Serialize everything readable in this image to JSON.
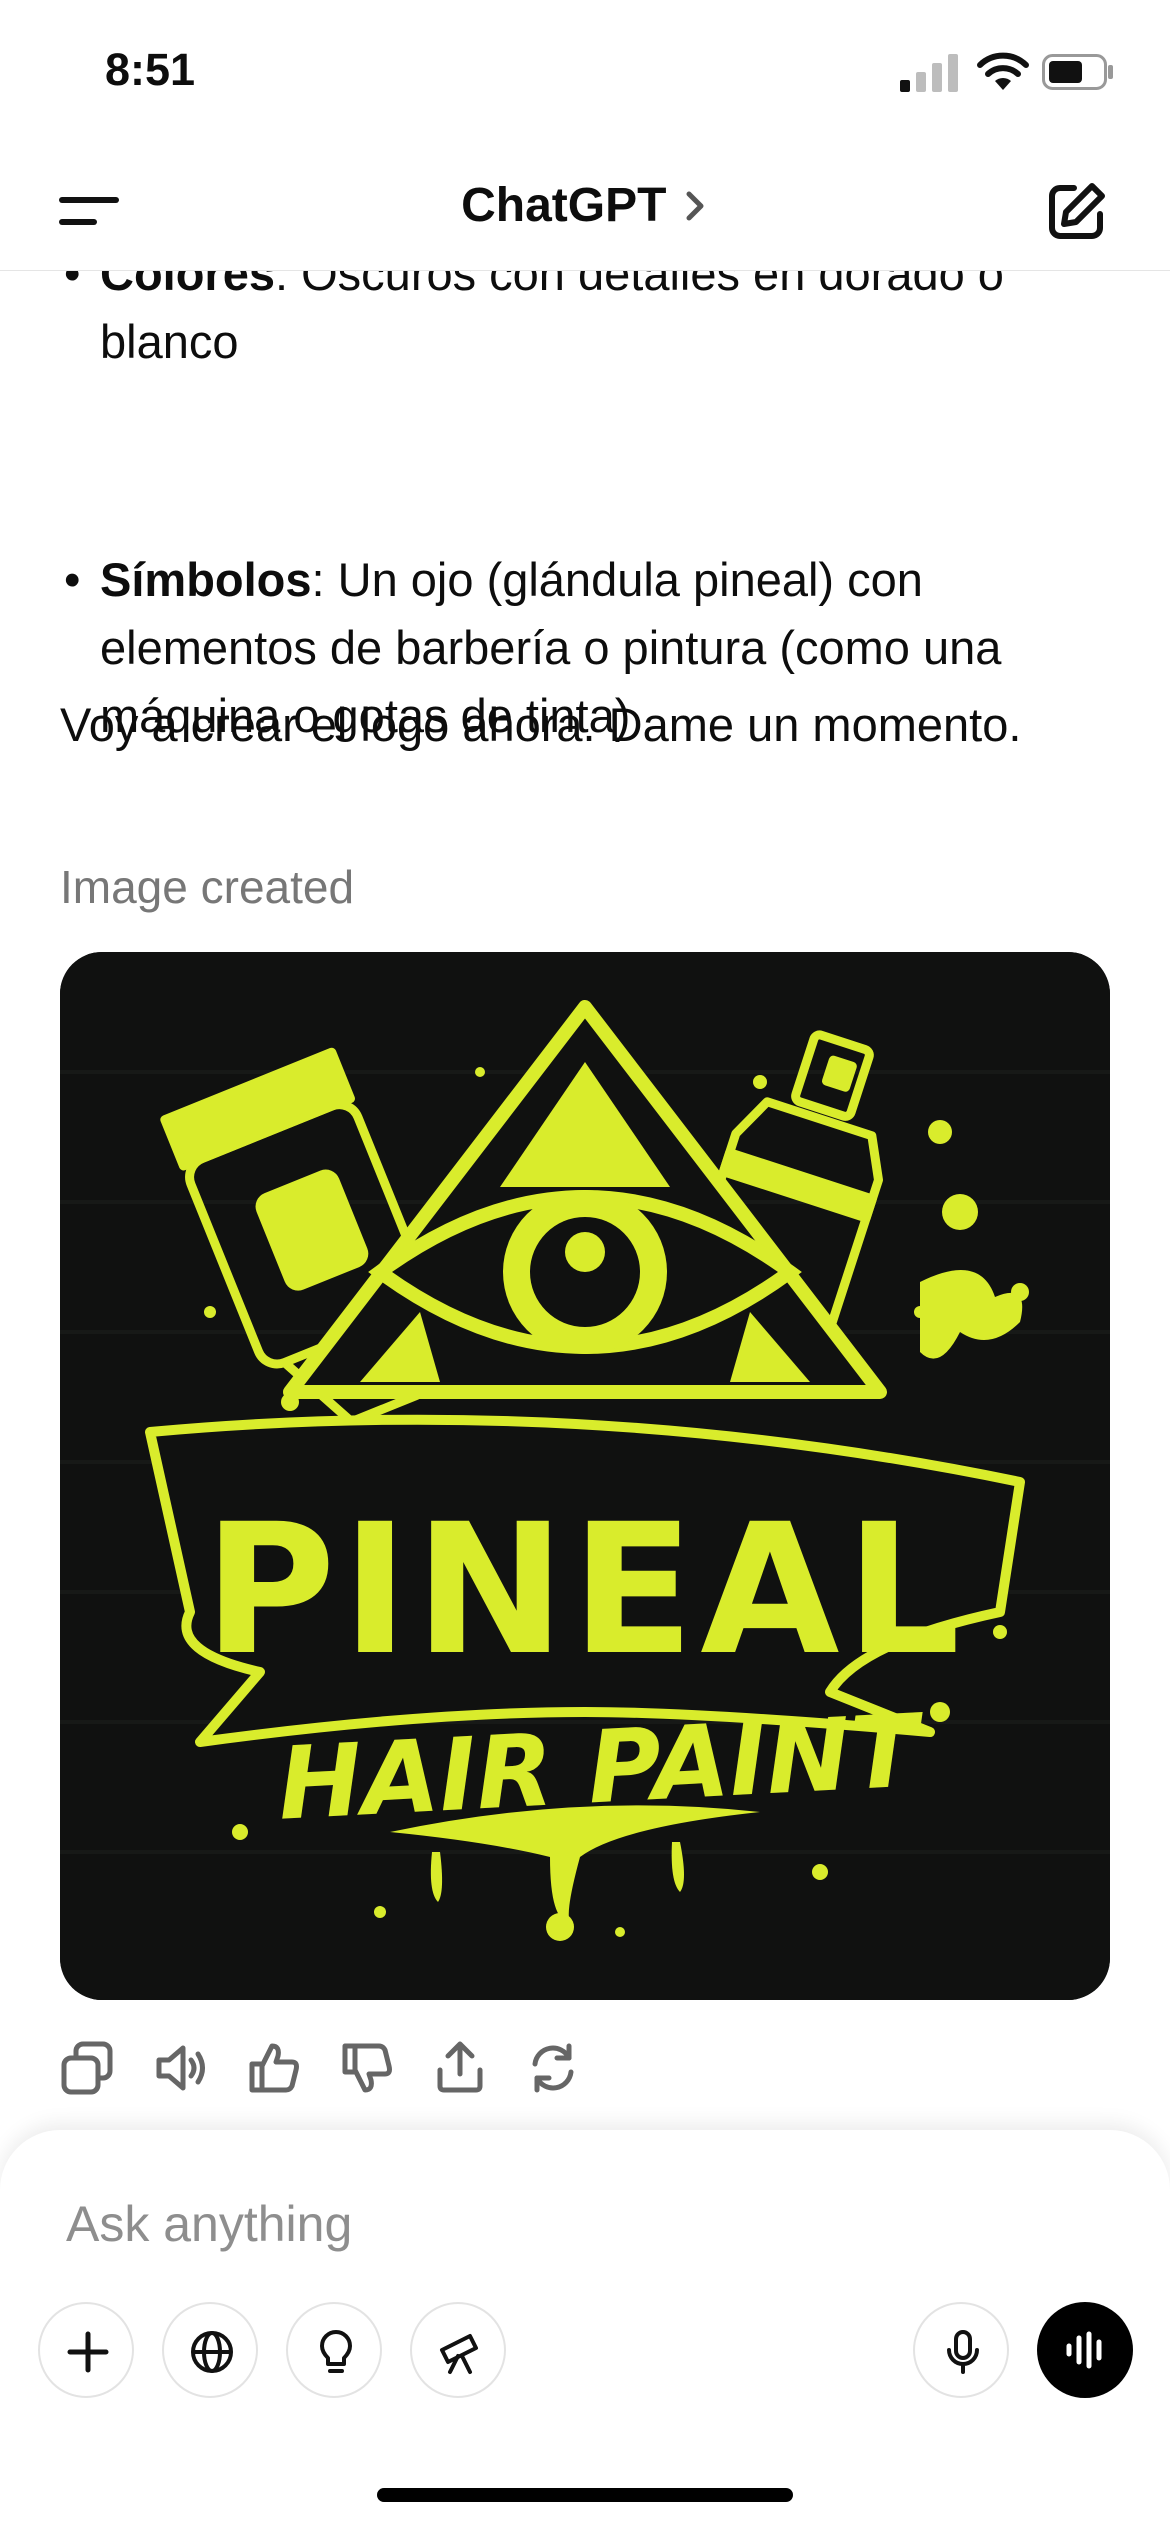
{
  "status_bar": {
    "time": "8:51"
  },
  "navbar": {
    "title": "ChatGPT",
    "icons": [
      "menu-icon",
      "chevron-right-icon",
      "new-chat-icon"
    ]
  },
  "message": {
    "bullets": [
      {
        "label": "Colores",
        "text": ": Oscuros con detalles en dorado o blanco"
      },
      {
        "label": "Símbolos",
        "text": ": Un ojo (glándula pineal) con elementos de barbería o pintura (como una máquina o gotas de tinta)"
      }
    ],
    "paragraph": "Voy a crear el logo ahora. Dame un momento.",
    "image_label": "Image created",
    "logo": {
      "line1": "PINEAL",
      "line2": "HAIR PAINT",
      "accent_color": "#d9ec2c",
      "background_color": "#101110"
    }
  },
  "message_actions": [
    "copy-icon",
    "read-aloud-icon",
    "thumbs-up-icon",
    "thumbs-down-icon",
    "share-icon",
    "regenerate-icon"
  ],
  "composer": {
    "placeholder": "Ask anything",
    "tools": [
      "plus-icon",
      "globe-icon",
      "lightbulb-icon",
      "telescope-icon"
    ],
    "right_buttons": [
      "microphone-icon",
      "voice-mode-icon"
    ]
  }
}
